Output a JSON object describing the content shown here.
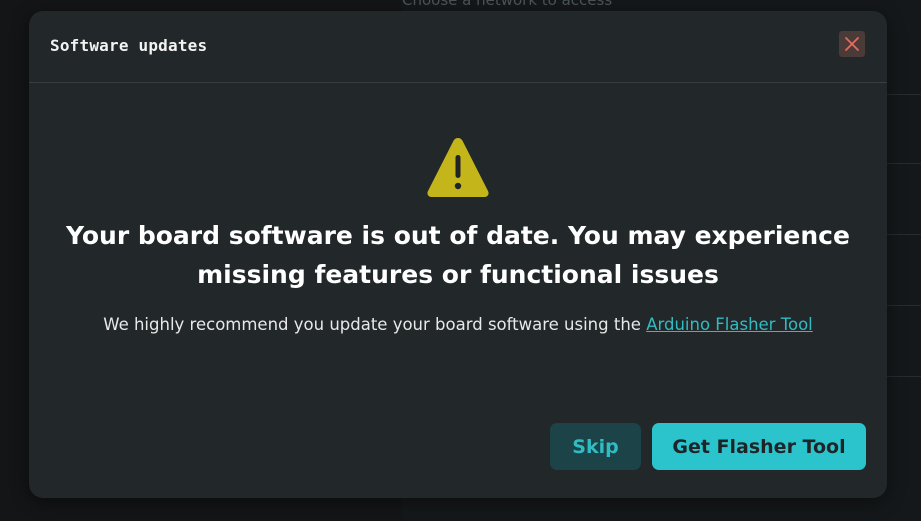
{
  "background": {
    "hint_text": "Choose a network to access"
  },
  "dialog": {
    "title": "Software updates",
    "close_icon": "close-icon",
    "warning_icon": "warning-triangle-icon",
    "headline_line1": "Your board software is out of date. You may experience",
    "headline_line2": "missing features or functional issues",
    "recommendation_text": "We highly recommend you update your board software using the",
    "flasher_link_label": "Arduino Flasher Tool",
    "skip_label": "Skip",
    "primary_label": "Get Flasher Tool"
  },
  "colors": {
    "accent": "#2cc4cc",
    "warning": "#c4b51b",
    "dialog_bg": "#22272a",
    "close_bg": "#4a3a38",
    "close_x": "#e56b5c"
  }
}
